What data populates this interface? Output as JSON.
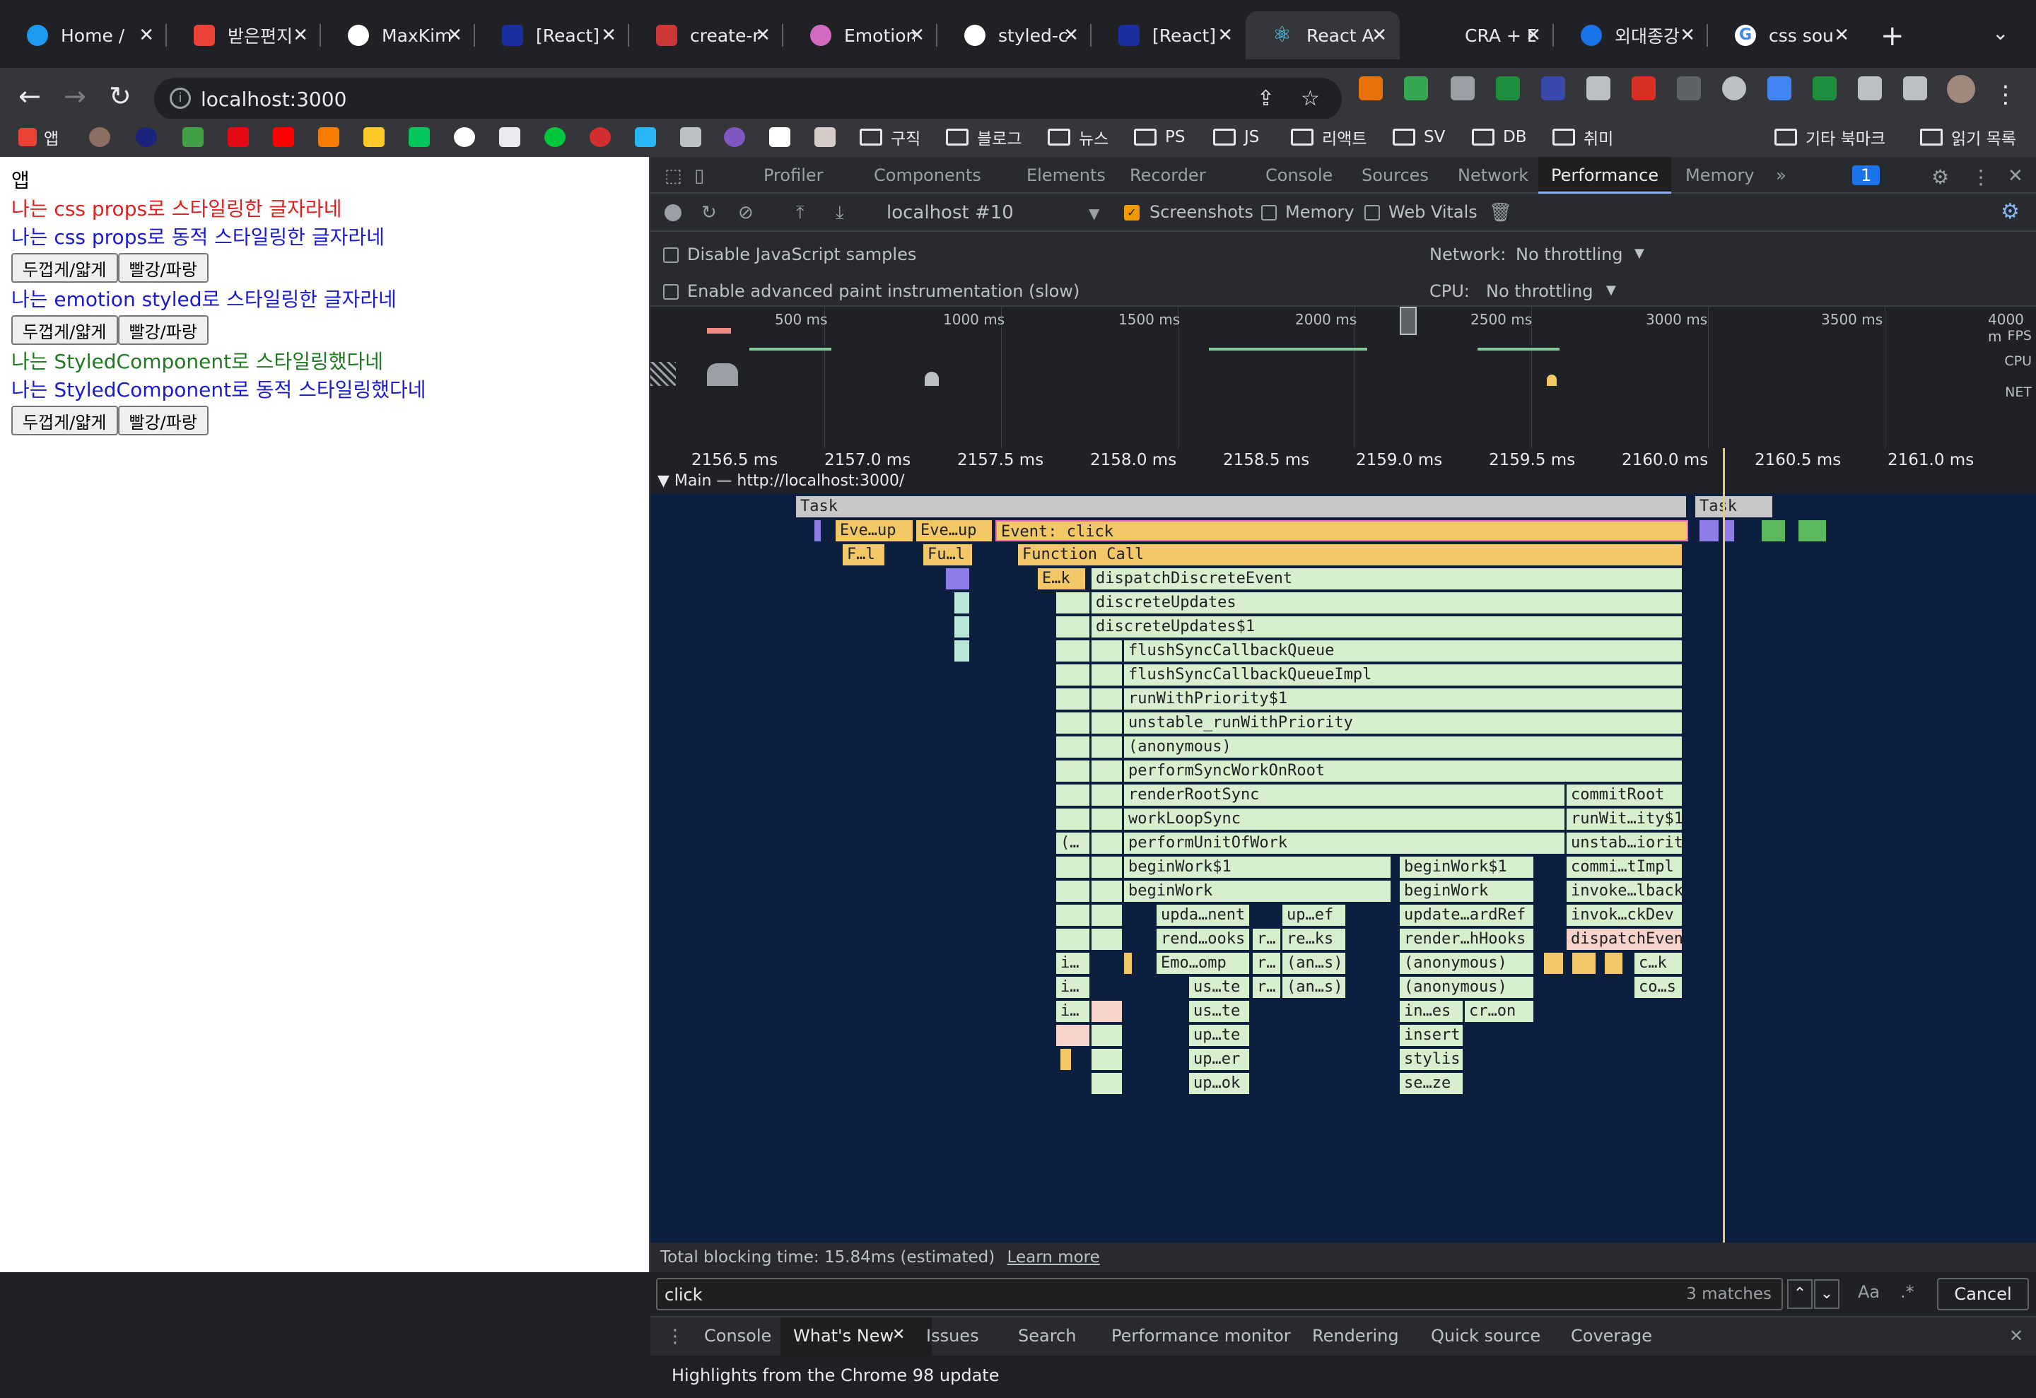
{
  "tabs": [
    {
      "label": "Home /",
      "color": "#1d9bf0"
    },
    {
      "label": "받은편지",
      "color": "#ea4335"
    },
    {
      "label": "MaxKim",
      "color": "#ffffff"
    },
    {
      "label": "[React]",
      "color": "#1b2ea0"
    },
    {
      "label": "create-r",
      "color": "#cb3837"
    },
    {
      "label": "Emotion",
      "color": "#d36ac2"
    },
    {
      "label": "styled-c",
      "color": "#ffffff"
    },
    {
      "label": "[React]",
      "color": "#1b2ea0"
    },
    {
      "label": "React A",
      "color": "#61dafb",
      "active": true
    },
    {
      "label": "CRA + E",
      "color": "#888888"
    },
    {
      "label": "외대종강",
      "color": "#1a73e8"
    },
    {
      "label": "css sou",
      "color": "#4285f4"
    }
  ],
  "omnibox": {
    "url": "localhost:3000"
  },
  "bookmarks": {
    "apps": "앱",
    "folders": [
      "구직",
      "블로그",
      "뉴스",
      "PS",
      "JS",
      "리액트",
      "SV",
      "DB",
      "취미"
    ],
    "other": "기타 북마크",
    "reading": "읽기 목록"
  },
  "page": {
    "title": "앱",
    "line1": "나는 css props로 스타일링한 글자라네",
    "line2": "나는 css props로 동적 스타일링한 글자라네",
    "line3": "나는 emotion styled로 스타일링한 글자라네",
    "line4": "나는 StyledComponent로 스타일링했다네",
    "line5": "나는 StyledComponent로 동적 스타일링했다네",
    "btn_bold": "두껍게/얇게",
    "btn_color": "빨강/파랑"
  },
  "devtools": {
    "tabs": [
      "Profiler",
      "Components",
      "Elements",
      "Recorder",
      "Console",
      "Sources",
      "Network",
      "Performance",
      "Memory"
    ],
    "issues_count": "1",
    "profile_select": "localhost #10",
    "screenshots": "Screenshots",
    "memory": "Memory",
    "web_vitals": "Web Vitals",
    "disable_js": "Disable JavaScript samples",
    "advanced_paint": "Enable advanced paint instrumentation (slow)",
    "network_label": "Network:",
    "network_value": "No throttling",
    "cpu_label": "CPU:",
    "cpu_value": "No throttling",
    "overview_ticks": [
      "500 ms",
      "1000 ms",
      "1500 ms",
      "2000 ms",
      "2500 ms",
      "3000 ms",
      "3500 ms",
      "4000 m"
    ],
    "overview_side": [
      "FPS",
      "CPU",
      "NET"
    ],
    "ruler_ticks": [
      "2156.5 ms",
      "2157.0 ms",
      "2157.5 ms",
      "2158.0 ms",
      "2158.5 ms",
      "2159.0 ms",
      "2159.5 ms",
      "2160.0 ms",
      "2160.5 ms",
      "2161.0 ms"
    ],
    "main_label": "Main — http://localhost:3000/",
    "blocking_time": "Total blocking time: 15.84ms (estimated)",
    "learn_more": "Learn more",
    "find_value": "click",
    "find_matches": "3 matches",
    "find_case": "Aa",
    "find_regex": ".*",
    "find_cancel": "Cancel",
    "drawer_tabs": [
      "Console",
      "What's New",
      "Issues",
      "Search",
      "Performance monitor",
      "Rendering",
      "Quick source",
      "Coverage"
    ],
    "drawer_text": "Highlights from the Chrome 98 update"
  },
  "flame": {
    "task": "Task",
    "task2": "Task",
    "ev1": "Eve…up",
    "ev2": "Eve…up",
    "ev_click": "Event: click",
    "f1": "F…l",
    "f2": "Fu…l",
    "func_call": "Function Call",
    "ek": "E…k",
    "d1": "dispatchDiscreteEvent",
    "d2": "discreteUpdates",
    "d3": "discreteUpdates$1",
    "d4": "flushSyncCallbackQueue",
    "d5": "flushSyncCallbackQueueImpl",
    "d6": "runWithPriority$1",
    "d7": "unstable_runWithPriority",
    "d8": "(anonymous)",
    "d9": "performSyncWorkOnRoot",
    "d10": "renderRootSync",
    "d10b": "commitRoot",
    "d11": "workLoopSync",
    "d11b": "runWit…ity$1",
    "d12a": "(…",
    "d12": "performUnitOfWork",
    "d12b": "unstab…iority",
    "d13": "beginWork$1",
    "d13b": "beginWork$1",
    "d13c": "commi…tImpl",
    "d14": "beginWork",
    "d14b": "beginWork",
    "d14c": "invoke…lback",
    "d15a": "upda…nent",
    "d15b": "up…ef",
    "d15c": "update…ardRef",
    "d15d": "invok…ckDev",
    "d16a": "rend…ooks",
    "d16b": "r…",
    "d16c": "re…ks",
    "d16d": "render…hHooks",
    "d16e": "dispatchEvent",
    "d17a": "i…",
    "d17b": "Emo…omp",
    "d17c": "r…",
    "d17d": "(an…s)",
    "d17e": "(anonymous)",
    "d17f": "c…k",
    "d18a": "i…",
    "d18b": "us…te",
    "d18c": "r…",
    "d18d": "(an…s)",
    "d18e": "(anonymous)",
    "d18f": "co…s",
    "d19a": "i…",
    "d19b": "us…te",
    "d19c": "in…es",
    "d19d": "cr…on",
    "d20a": "up…te",
    "d20b": "insert",
    "d21a": "up…er",
    "d21b": "stylis",
    "d22a": "up…ok",
    "d22b": "se…ze"
  }
}
